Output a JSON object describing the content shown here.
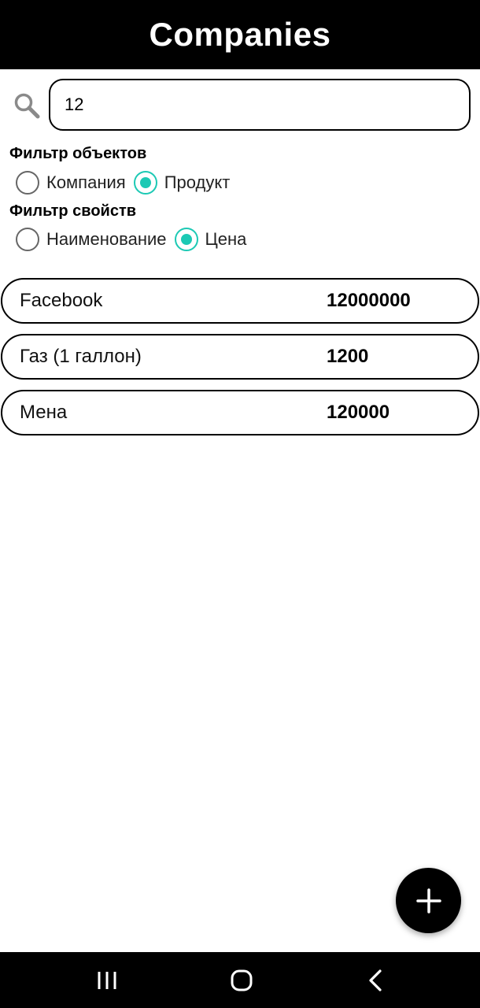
{
  "header": {
    "title": "Companies"
  },
  "search": {
    "value": "12",
    "icon": "search-icon"
  },
  "object_filter": {
    "heading": "Фильтр объектов",
    "options": [
      {
        "label": "Компания",
        "checked": false
      },
      {
        "label": "Продукт",
        "checked": true
      }
    ]
  },
  "property_filter": {
    "heading": "Фильтр свойств",
    "options": [
      {
        "label": "Наименование",
        "checked": false
      },
      {
        "label": "Цена",
        "checked": true
      }
    ]
  },
  "results": [
    {
      "name": "Facebook",
      "value": "12000000"
    },
    {
      "name": "Газ (1 галлон)",
      "value": "1200"
    },
    {
      "name": "Мена",
      "value": "120000"
    }
  ],
  "fab": {
    "icon": "plus-icon"
  },
  "navbar": {
    "icons": [
      "recent-apps-icon",
      "home-icon",
      "back-icon"
    ]
  },
  "colors": {
    "accent": "#1cc9b4",
    "header_bg": "#000000",
    "nav_bg": "#000000"
  }
}
